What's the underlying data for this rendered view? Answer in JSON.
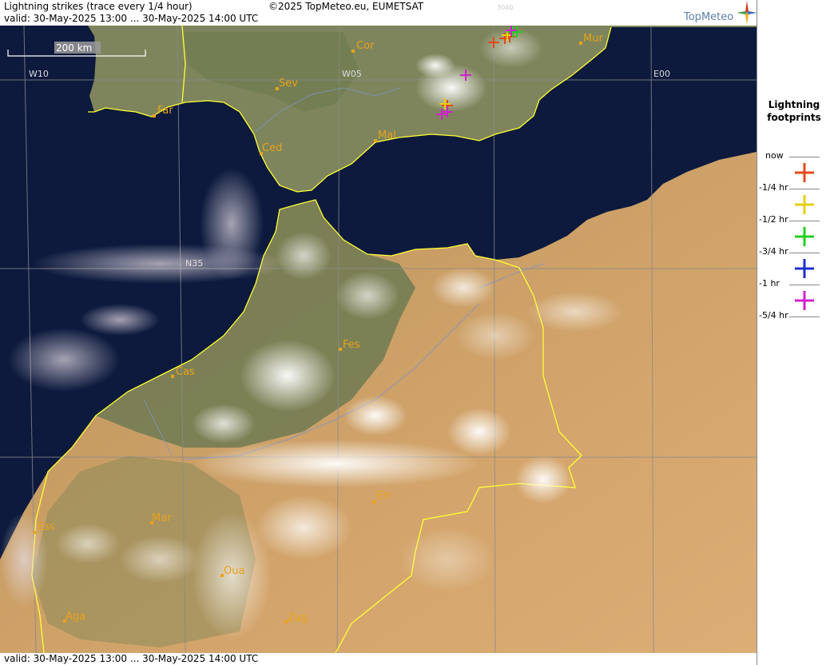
{
  "header": {
    "title": "Lightning strikes (trace every 1/4 hour)",
    "copyright": "©2025 TopMeteo.eu, EUMETSAT",
    "valid": "valid:  30-May-2025 13:00 ... 30-May-2025 14:00 UTC",
    "map_id": "3040",
    "logo": "TopMeteo"
  },
  "footer": {
    "valid": "valid:  30-May-2025 13:00 ... 30-May-2025 14:00 UTC"
  },
  "map": {
    "scale_label": "200 km",
    "grid_labels": {
      "w10": "W10",
      "w05": "W05",
      "e00": "E00",
      "n35": "N35"
    },
    "cities": [
      "Cor",
      "Mur",
      "Sev",
      "Far",
      "Mal",
      "Ced",
      "Fes",
      "Cas",
      "Err",
      "Ess",
      "Mar",
      "Oua",
      "Aga",
      "Zag"
    ],
    "colors": {
      "sea": "#0d1a3d",
      "iberia_land": "#7e855c",
      "morocco_north": "#6e7a52",
      "desert": "#caa06a",
      "border": "#ffff33",
      "grid": "#8a8a8a",
      "city": "#e8a31a",
      "river": "#7f94c9"
    }
  },
  "legend": {
    "title_line1": "Lightning",
    "title_line2": "footprints",
    "items": [
      {
        "label": "now",
        "color": null
      },
      {
        "label": "-1/4 hr",
        "color": "#e34a1a"
      },
      {
        "label": "-1/2 hr",
        "color": "#e6cf0e"
      },
      {
        "label": "-3/4 hr",
        "color": "#1fd020"
      },
      {
        "label": "-1 hr",
        "color": "#1c2ecf"
      },
      {
        "label": "-5/4 hr",
        "color": "#d21fd0"
      }
    ]
  }
}
